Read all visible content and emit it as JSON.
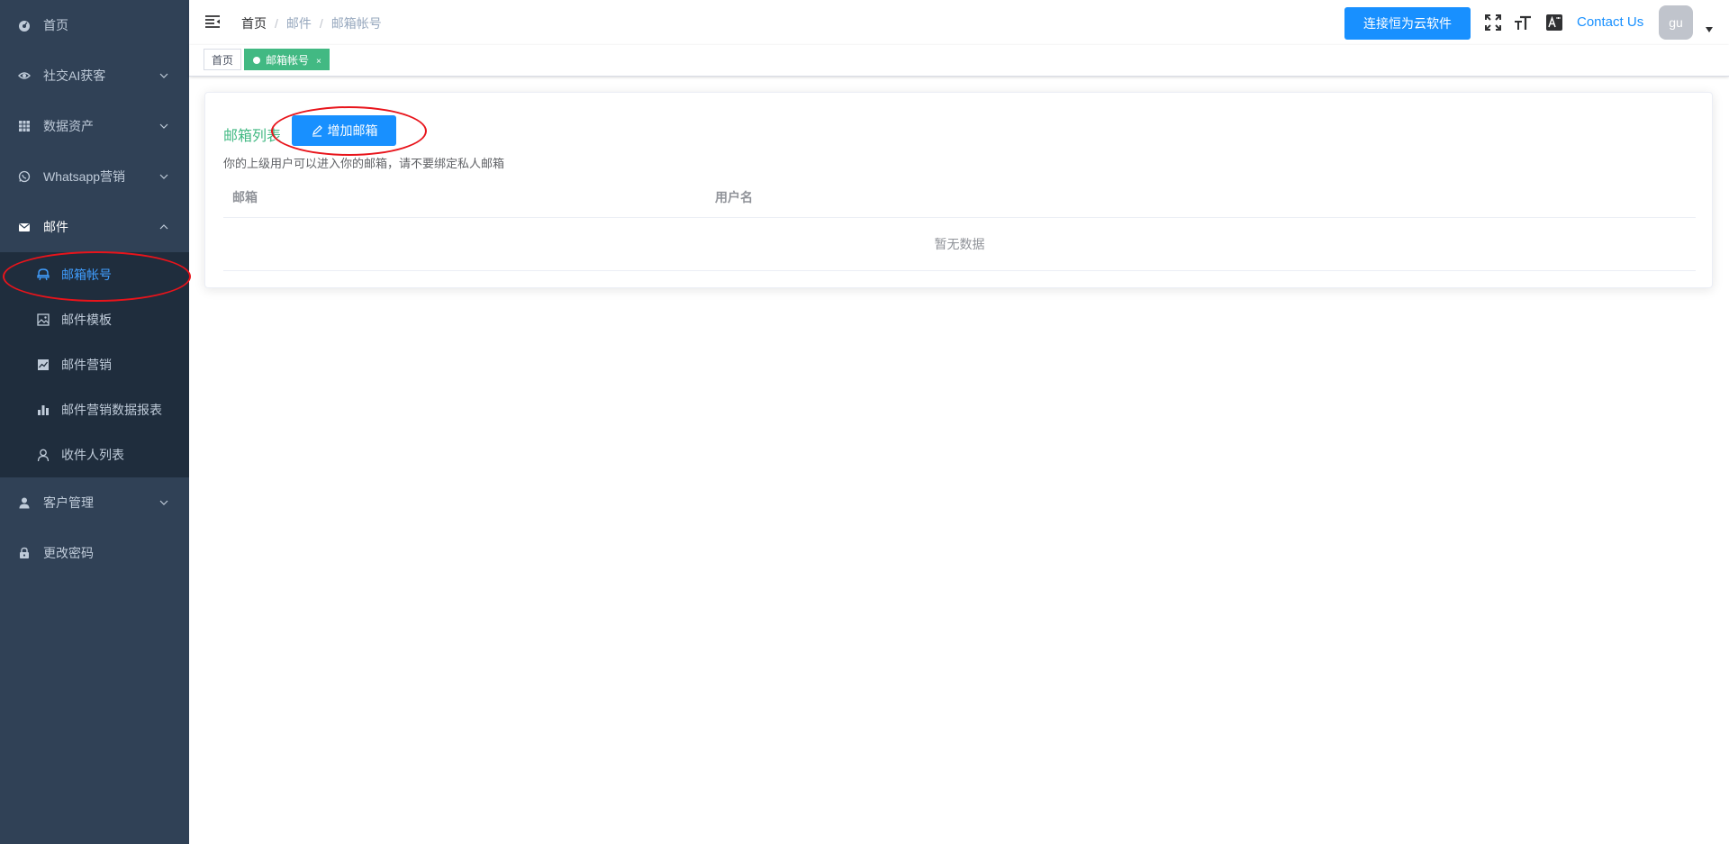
{
  "sidebar": {
    "items": [
      {
        "label": "首页",
        "icon": "dashboard-icon"
      },
      {
        "label": "社交AI获客",
        "icon": "eye-icon"
      },
      {
        "label": "数据资产",
        "icon": "grid-icon"
      },
      {
        "label": "Whatsapp营销",
        "icon": "whatsapp-icon"
      },
      {
        "label": "邮件",
        "icon": "mail-icon"
      },
      {
        "label": "客户管理",
        "icon": "user-icon"
      },
      {
        "label": "更改密码",
        "icon": "lock-icon"
      }
    ],
    "mail_submenu": [
      {
        "label": "邮箱帐号",
        "icon": "mail-account-icon",
        "active": true
      },
      {
        "label": "邮件模板",
        "icon": "image-icon"
      },
      {
        "label": "邮件营销",
        "icon": "line-chart-icon"
      },
      {
        "label": "邮件营销数据报表",
        "icon": "bar-chart-icon"
      },
      {
        "label": "收件人列表",
        "icon": "person-icon"
      }
    ]
  },
  "navbar": {
    "breadcrumb": [
      "首页",
      "邮件",
      "邮箱帐号"
    ],
    "connect_button": "连接恒为云软件",
    "contact_us": "Contact Us",
    "avatar_text": "gu"
  },
  "tags": {
    "home": "首页",
    "active": "邮箱帐号",
    "close": "×"
  },
  "card": {
    "title": "邮箱列表",
    "add_button": "增加邮箱",
    "tip": "你的上级用户可以进入你的邮箱，请不要绑定私人邮箱",
    "columns": [
      "邮箱",
      "用户名"
    ],
    "empty_text": "暂无数据"
  },
  "colors": {
    "sidebar_bg": "#304156",
    "submenu_bg": "#1f2d3d",
    "primary": "#1890ff",
    "active_tag": "#42b983",
    "annotation": "#e8141b"
  }
}
